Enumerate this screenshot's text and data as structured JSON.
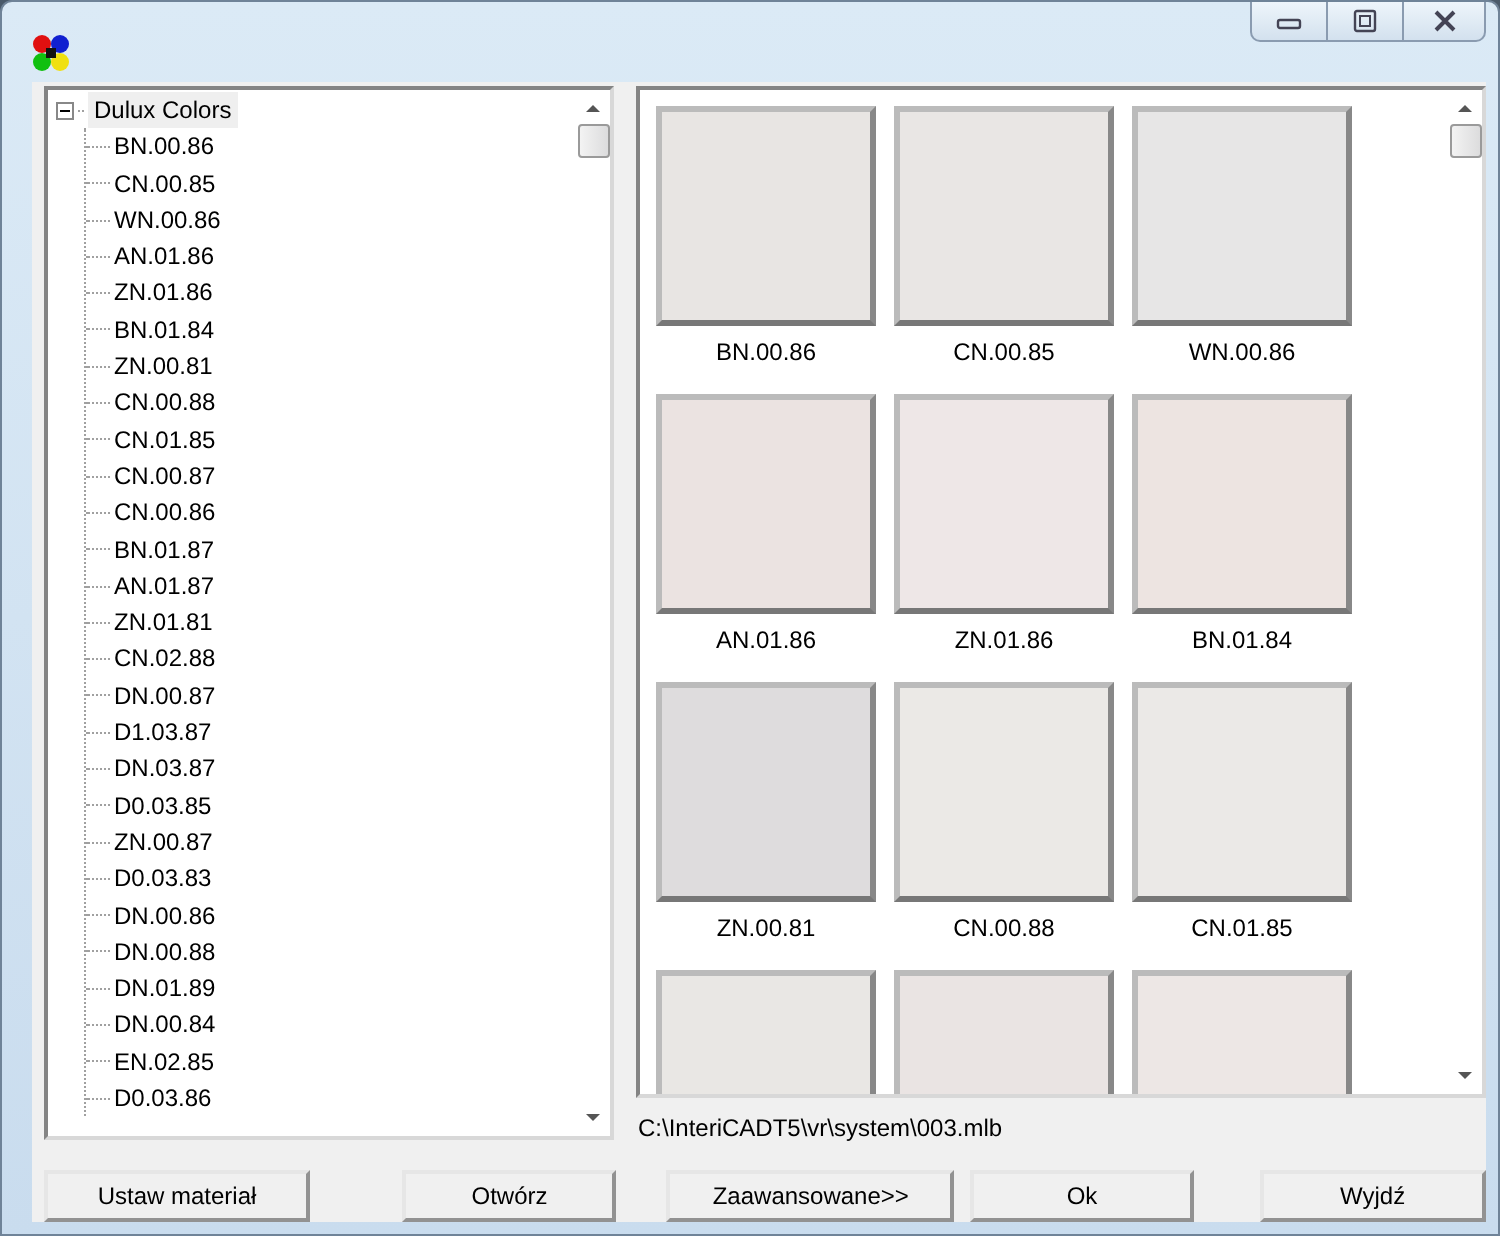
{
  "tree": {
    "label": "Dulux Colors",
    "expanded": true,
    "children": [
      {
        "label": "BN.00.86"
      },
      {
        "label": "CN.00.85"
      },
      {
        "label": "WN.00.86"
      },
      {
        "label": "AN.01.86"
      },
      {
        "label": "ZN.01.86"
      },
      {
        "label": "BN.01.84"
      },
      {
        "label": "ZN.00.81"
      },
      {
        "label": "CN.00.88"
      },
      {
        "label": "CN.01.85"
      },
      {
        "label": "CN.00.87"
      },
      {
        "label": "CN.00.86"
      },
      {
        "label": "BN.01.87"
      },
      {
        "label": "AN.01.87"
      },
      {
        "label": "ZN.01.81"
      },
      {
        "label": "CN.02.88"
      },
      {
        "label": "DN.00.87"
      },
      {
        "label": "D1.03.87"
      },
      {
        "label": "DN.03.87"
      },
      {
        "label": "D0.03.85"
      },
      {
        "label": "ZN.00.87"
      },
      {
        "label": "D0.03.83"
      },
      {
        "label": "DN.00.86"
      },
      {
        "label": "DN.00.88"
      },
      {
        "label": "DN.01.89"
      },
      {
        "label": "DN.00.84"
      },
      {
        "label": "EN.02.85"
      },
      {
        "label": "D0.03.86"
      }
    ]
  },
  "swatches": [
    {
      "name": "BN.00.86",
      "color": "#e8e5e3"
    },
    {
      "name": "CN.00.85",
      "color": "#e9e6e4"
    },
    {
      "name": "WN.00.86",
      "color": "#e7e6e6"
    },
    {
      "name": "AN.01.86",
      "color": "#ebe3e1"
    },
    {
      "name": "ZN.01.86",
      "color": "#eee7e7"
    },
    {
      "name": "BN.01.84",
      "color": "#ede4e1"
    },
    {
      "name": "ZN.00.81",
      "color": "#dedcdd"
    },
    {
      "name": "CN.00.88",
      "color": "#ebe9e6"
    },
    {
      "name": "CN.01.85",
      "color": "#ebe9e7"
    },
    {
      "color": "#e9e7e4"
    },
    {
      "color": "#eae4e3"
    },
    {
      "color": "#ede7e5"
    }
  ],
  "path": "C:\\InteriCADT5\\vr\\system\\003.mlb",
  "buttons": [
    "Ustaw materiał",
    "Otwórz",
    "Zaawansowane>>",
    "Ok",
    "Wyjdź"
  ]
}
